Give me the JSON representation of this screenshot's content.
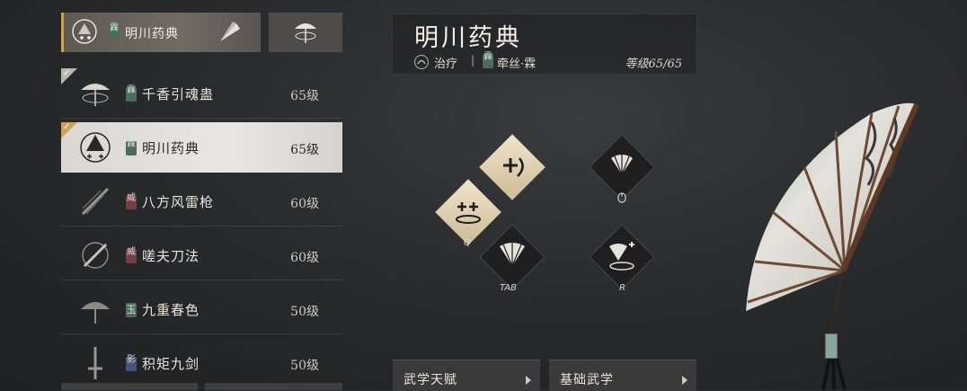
{
  "equipped": {
    "tag": "霖",
    "name": "明川药典"
  },
  "weapons": [
    {
      "tag": "霖",
      "tag_color": "green",
      "name": "千香引魂蛊",
      "level": "65级",
      "checked": true,
      "check_style": "plain"
    },
    {
      "tag": "霖",
      "tag_color": "green",
      "name": "明川药典",
      "level": "65级",
      "selected": true,
      "checked": true,
      "check_style": "gold"
    },
    {
      "tag": "威",
      "tag_color": "red",
      "name": "八方风雷枪",
      "level": "60级"
    },
    {
      "tag": "威",
      "tag_color": "red",
      "name": "嗟夫刀法",
      "level": "60级"
    },
    {
      "tag": "玉",
      "tag_color": "jade",
      "name": "九重春色",
      "level": "50级"
    },
    {
      "tag": "影",
      "tag_color": "blue",
      "name": "积矩九剑",
      "level": "50级"
    }
  ],
  "info": {
    "title": "明川药典",
    "role": "治疗",
    "separator": "|",
    "sect_tag": "霖",
    "sect": "牵丝·霖",
    "level": "等级65/65"
  },
  "skills": {
    "keys": {
      "q": "Q",
      "tilde": "~",
      "tab": "TAB",
      "r": "R"
    }
  },
  "panels": [
    {
      "label": "武学天赋"
    },
    {
      "label": "基础武学"
    }
  ]
}
